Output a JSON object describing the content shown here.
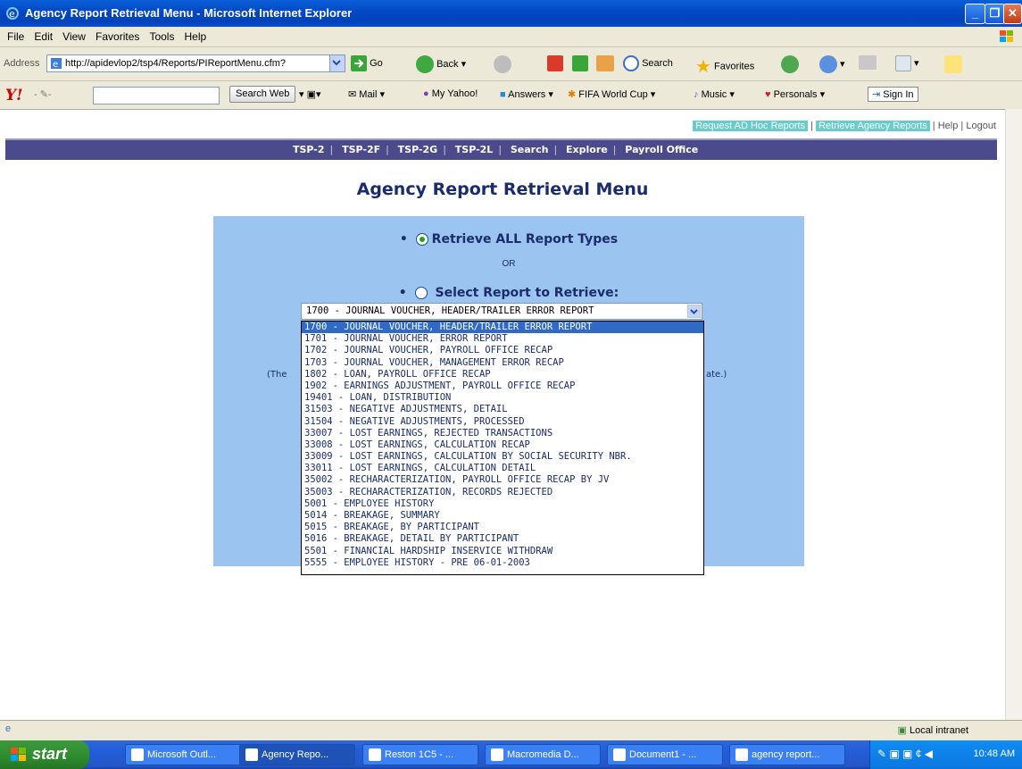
{
  "window": {
    "title": "Agency Report Retrieval Menu - Microsoft Internet Explorer"
  },
  "menu": [
    "File",
    "Edit",
    "View",
    "Favorites",
    "Tools",
    "Help"
  ],
  "address": {
    "label": "Address",
    "url": "http://apidevlop2/tsp4/Reports/PIReportMenu.cfm?",
    "go": "Go"
  },
  "toolbar": {
    "back": "Back",
    "search": "Search",
    "favorites": "Favorites"
  },
  "yahoo": {
    "logo": "Y!",
    "search_button": "Search Web",
    "mail": "Mail",
    "my_yahoo": "My Yahoo!",
    "answers": "Answers",
    "fifa": "FIFA World Cup",
    "music": "Music",
    "personals": "Personals",
    "sign_in": "Sign In"
  },
  "toplinks": {
    "adhoc": "Request AD Hoc Reports",
    "retrieve": "Retrieve Agency Reports",
    "help": "Help",
    "logout": "Logout"
  },
  "nav": [
    "TSP-2",
    "TSP-2F",
    "TSP-2G",
    "TSP-2L",
    "Search",
    "Explore",
    "Payroll Office"
  ],
  "page": {
    "heading": "Agency Report Retrieval Menu",
    "option_all": "Retrieve ALL Report Types",
    "or": "OR",
    "option_select": "Select Report to Retrieve:",
    "partial_left": "(The",
    "partial_right": "ate.)"
  },
  "select": {
    "value": "1700 - JOURNAL VOUCHER, HEADER/TRAILER ERROR REPORT",
    "options": [
      "1700 - JOURNAL VOUCHER, HEADER/TRAILER ERROR REPORT",
      "1701 - JOURNAL VOUCHER, ERROR REPORT",
      "1702 - JOURNAL VOUCHER, PAYROLL OFFICE RECAP",
      "1703 - JOURNAL VOUCHER, MANAGEMENT ERROR RECAP",
      "1802 - LOAN, PAYROLL OFFICE RECAP",
      "1902 - EARNINGS ADJUSTMENT, PAYROLL OFFICE RECAP",
      "19401 - LOAN, DISTRIBUTION",
      "31503 - NEGATIVE ADJUSTMENTS, DETAIL",
      "31504 - NEGATIVE ADJUSTMENTS, PROCESSED",
      "33007 - LOST EARNINGS, REJECTED TRANSACTIONS",
      "33008 - LOST EARNINGS, CALCULATION RECAP",
      "33009 - LOST EARNINGS, CALCULATION BY SOCIAL SECURITY NBR.",
      "33011 - LOST EARNINGS, CALCULATION DETAIL",
      "35002 - RECHARACTERIZATION, PAYROLL OFFICE RECAP BY JV",
      "35003 - RECHARACTERIZATION, RECORDS REJECTED",
      "5001 - EMPLOYEE HISTORY",
      "5014 - BREAKAGE, SUMMARY",
      "5015 - BREAKAGE, BY PARTICIPANT",
      "5016 - BREAKAGE, DETAIL BY PARTICIPANT",
      "5501 - FINANCIAL HARDSHIP INSERVICE WITHDRAW",
      "5555 - EMPLOYEE HISTORY - PRE 06-01-2003"
    ]
  },
  "status": {
    "zone": "Local intranet"
  },
  "taskbar": {
    "start": "start",
    "buttons": [
      "Microsoft Outl...",
      "Agency Repo...",
      "Reston 1C5 - ...",
      "Macromedia D...",
      "Document1 - ...",
      "agency report..."
    ],
    "clock": "10:48 AM"
  }
}
